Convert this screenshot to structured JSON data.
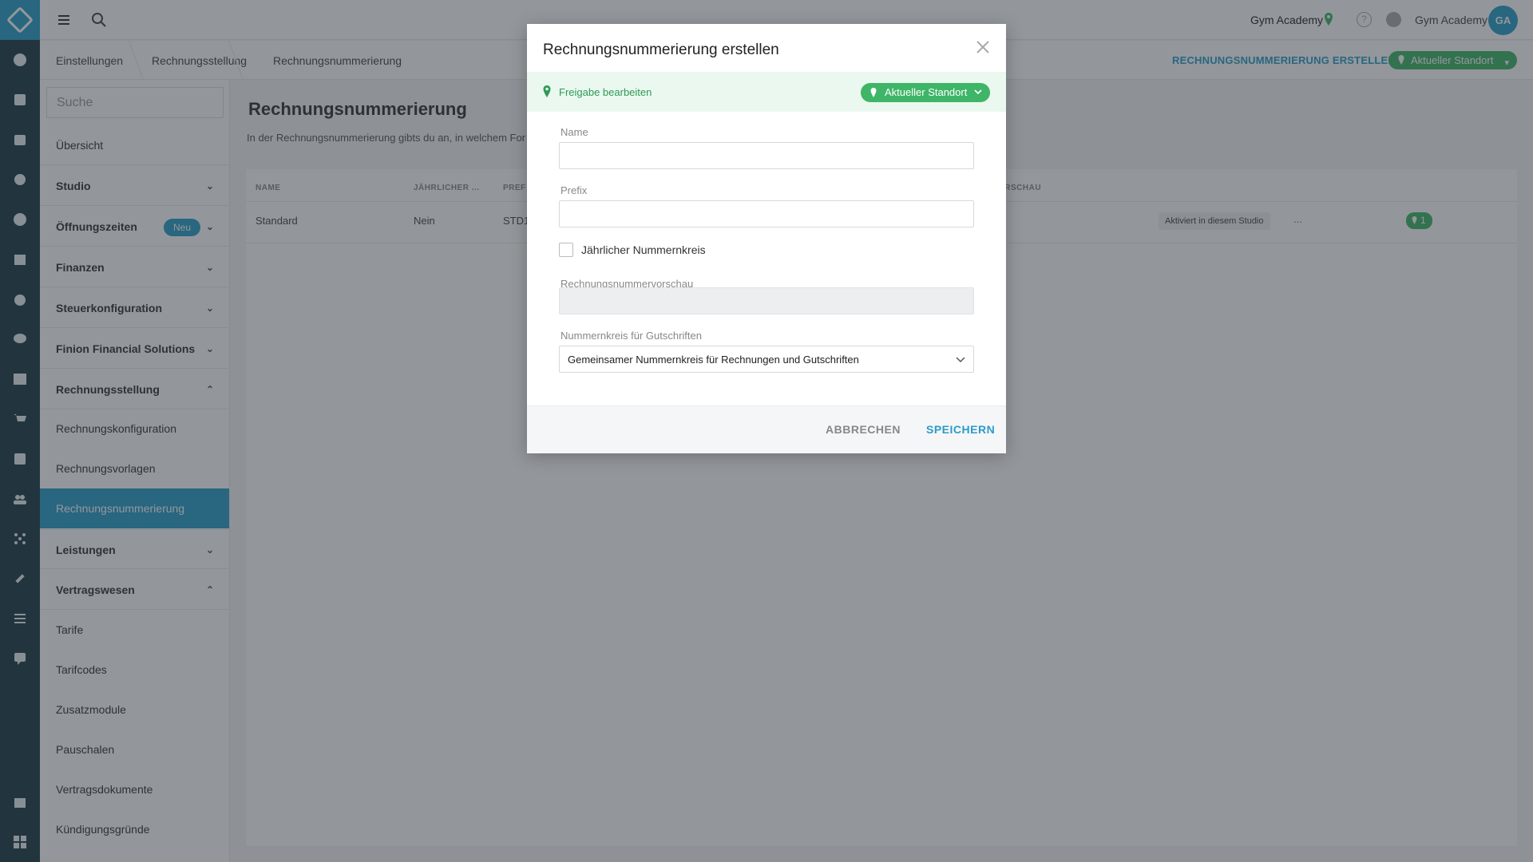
{
  "topbar": {
    "studio_name": "Gym Academy",
    "user_name": "Gym Academy",
    "avatar_initials": "GA",
    "help_symbol": "?"
  },
  "breadcrumb": [
    "Einstellungen",
    "Rechnungsstellung",
    "Rechnungsnummerierung"
  ],
  "page_actions": {
    "create_label": "RECHNUNGSNUMMERIERUNG ERSTELLEN",
    "location_filter": "Aktueller Standort"
  },
  "sidebar": {
    "search_placeholder": "Suche",
    "items": [
      {
        "label": "Übersicht"
      },
      {
        "label": "Studio"
      },
      {
        "label": "Öffnungszeiten",
        "badge": "Neu"
      },
      {
        "label": "Finanzen"
      },
      {
        "label": "Steuerkonfiguration"
      },
      {
        "label": "Finion Financial Solutions"
      },
      {
        "label": "Rechnungsstellung"
      },
      {
        "label": "Rechnungskonfiguration"
      },
      {
        "label": "Rechnungsvorlagen"
      },
      {
        "label": "Rechnungsnummerierung"
      },
      {
        "label": "Leistungen"
      },
      {
        "label": "Vertragswesen"
      },
      {
        "label": "Tarife"
      },
      {
        "label": "Tarifcodes"
      },
      {
        "label": "Zusatzmodule"
      },
      {
        "label": "Pauschalen"
      },
      {
        "label": "Vertragsdokumente"
      },
      {
        "label": "Kündigungsgründe"
      }
    ]
  },
  "main": {
    "title": "Rechnungsnummerierung",
    "intro": "In der Rechnungsnummerierung gibts du an, in welchem For",
    "columns": [
      "NAME",
      "JÄHRLICHER ...",
      "PREF",
      "ORSCHAU"
    ],
    "rows": [
      {
        "name": "Standard",
        "yearly": "Nein",
        "prefix": "STD1",
        "availability": "Aktiviert in diesem Studio",
        "more": "...",
        "locations": "1"
      }
    ]
  },
  "modal": {
    "title": "Rechnungsnummerierung erstellen",
    "share_label": "Freigabe bearbeiten",
    "share_location": "Aktueller Standort",
    "name_label": "Name",
    "name_value": "",
    "prefix_label": "Prefix",
    "prefix_value": "",
    "yearly_label": "Jährlicher Nummernkreis",
    "yearly_checked": false,
    "preview_label": "Rechnungsnummervorschau",
    "preview_value": "",
    "credit_label": "Nummernkreis für Gutschriften",
    "credit_value": "Gemeinsamer Nummernkreis für Rechnungen und Gutschriften",
    "cancel_label": "ABBRECHEN",
    "save_label": "SPEICHERN"
  },
  "colors": {
    "accent": "#2a9cc9",
    "rail": "#1c3a47",
    "success": "#3fb567",
    "success_text": "#2f9a57",
    "share_bg": "#eaf8ef"
  }
}
